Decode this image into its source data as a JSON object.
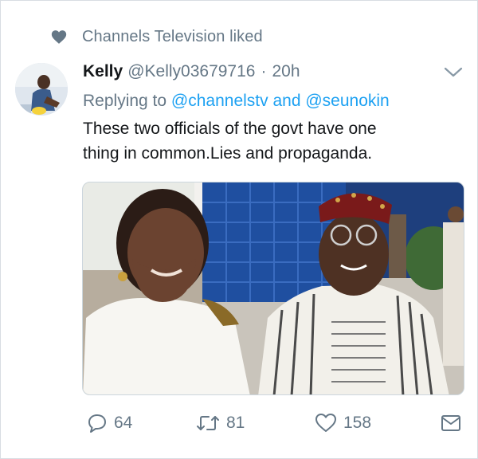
{
  "social_context": {
    "icon": "heart-icon",
    "text": "Channels Television liked"
  },
  "tweet": {
    "author": {
      "display_name": "Kelly",
      "handle": "@Kelly03679716",
      "avatar": "avatar-photo"
    },
    "separator": "·",
    "timestamp": "20h",
    "replying": {
      "prefix": "Replying to",
      "mention_1": "@channelstv",
      "joiner": "and",
      "mention_2": "@seunokin"
    },
    "text_line_1": "These two officials of the govt have one",
    "text_line_2": "thing in common.Lies and propaganda.",
    "media": "photo of a woman and a man in traditional attire"
  },
  "actions": {
    "reply_icon": "reply-icon",
    "reply_count": "64",
    "retweet_icon": "retweet-icon",
    "retweet_count": "81",
    "like_icon": "heart-outline-icon",
    "like_count": "158",
    "dm_icon": "envelope-icon"
  },
  "colors": {
    "link": "#1da1f2",
    "secondary": "#657786",
    "text": "#14171a"
  }
}
